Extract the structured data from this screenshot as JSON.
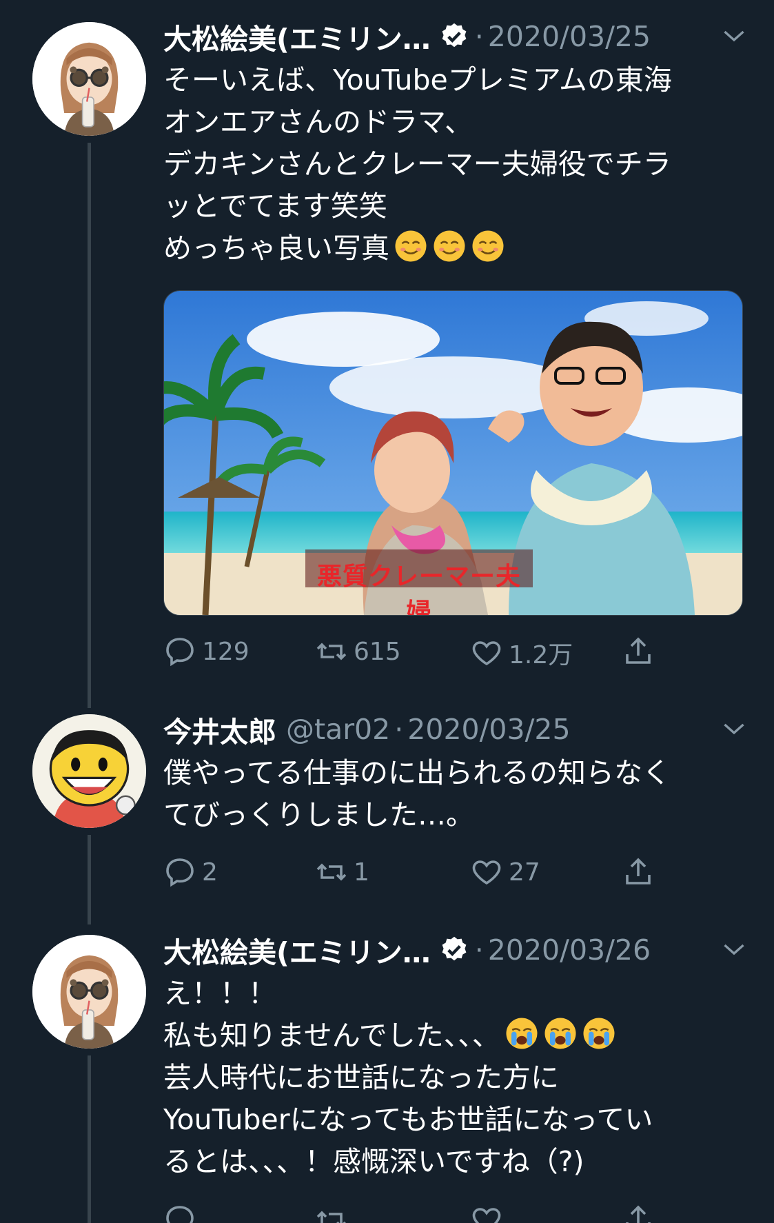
{
  "tweets": [
    {
      "author_name": "大松絵美(エミリン…",
      "verified": true,
      "handle": "",
      "separator": "·",
      "date": "2020/03/25",
      "lines": [
        "そーいえば、YouTubeプレミアムの東海",
        "オンエアさんのドラマ、",
        "デカキンさんとクレーマー夫婦役でチラ",
        "ッとでてます笑笑",
        "めっちゃ良い写真"
      ],
      "emoji_suffix": [
        "smiling-face-icon",
        "smiling-face-icon",
        "smiling-face-icon"
      ],
      "media_caption": "悪質クレーマー夫婦",
      "reply_count": "129",
      "retweet_count": "615",
      "like_count": "1.2万"
    },
    {
      "author_name": "今井太郎",
      "verified": false,
      "handle": "@tar02",
      "separator": "·",
      "date": "2020/03/25",
      "lines": [
        "僕やってる仕事のに出られるの知らなく",
        "てびっくりしました…。"
      ],
      "reply_count": "2",
      "retweet_count": "1",
      "like_count": "27"
    },
    {
      "author_name": "大松絵美(エミリン…",
      "verified": true,
      "handle": "",
      "separator": "·",
      "date": "2020/03/26",
      "lines": [
        "え！！！",
        "私も知りませんでした、、、",
        "芸人時代にお世話になった方に",
        "YouTuberになってもお世話になってい",
        "るとは、、、！感慨深いですね（?)"
      ],
      "emoji_suffix": [
        "crying-face-icon",
        "crying-face-icon",
        "crying-face-icon"
      ]
    }
  ],
  "colors": {
    "background": "#15202b",
    "text": "#ffffff",
    "muted": "#8899a6",
    "thread_line": "#38444d"
  }
}
